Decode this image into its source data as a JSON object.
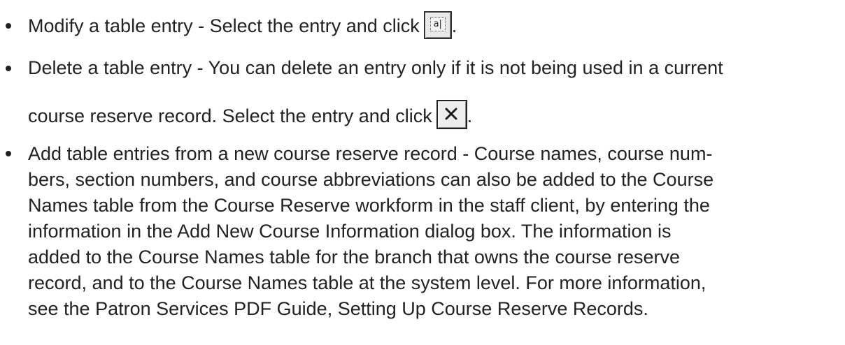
{
  "items": [
    {
      "lines": [
        "Modify a table entry - Select the entry and click"
      ],
      "trailing": ".",
      "icon": "modify-entry-icon"
    },
    {
      "lines": [
        "Delete a table entry - You can delete an entry only if it is not being used in a current",
        "course reserve record. Select the entry and click"
      ],
      "trailing": ".",
      "icon": "delete-entry-icon"
    },
    {
      "lines": [
        "Add table entries from a new course reserve record - Course names, course num-",
        "bers, section numbers, and course abbreviations can also be added to the Course",
        "Names table from the Course Reserve workform in the staff client, by entering the",
        "information in the Add New Course Information dialog box. The information is",
        "added to the Course Names table for the branch that owns the course reserve",
        "record, and to the Course Names table at the system level. For more information,",
        "see the Patron Services PDF Guide, Setting Up Course Reserve Records."
      ]
    }
  ],
  "icon_glyphs": {
    "modify": "a|"
  },
  "colors": {
    "text": "#222222",
    "button_face": "#e9e9e9"
  }
}
